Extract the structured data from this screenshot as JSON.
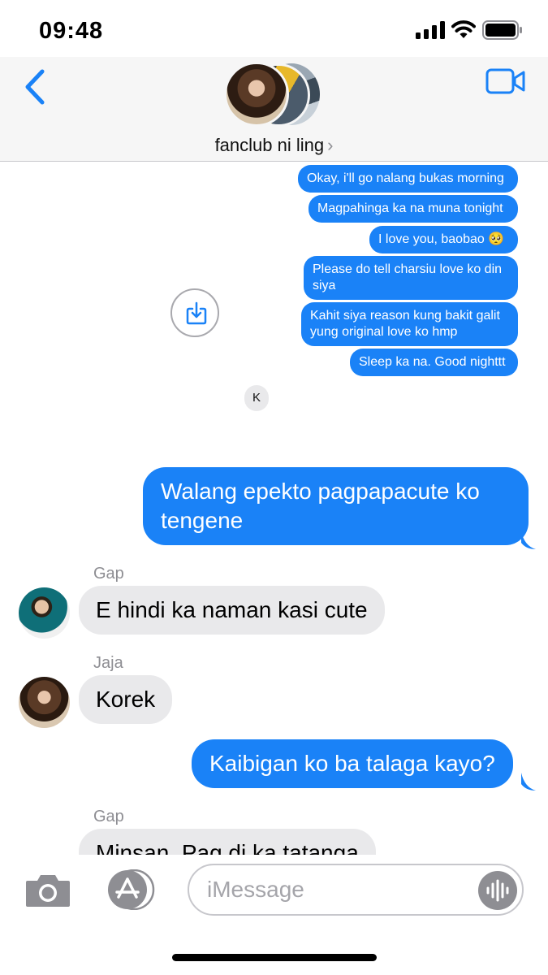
{
  "status_bar": {
    "time": "09:48"
  },
  "header": {
    "group_name": "fanclub ni ling",
    "chevron": "›",
    "icons": {
      "back": "chevron-left-icon",
      "video": "video-camera-icon"
    },
    "accent_color": "#1a82f7"
  },
  "quoted_screenshot": {
    "outgoing_messages": [
      "Okay, i'll go nalang bukas morning",
      "Magpahinga ka na muna tonight",
      "I love you, baobao 🥺",
      "Please do tell charsiu love ko din siya",
      "Kahit siya reason kung bakit galit yung original love ko hmp",
      "Sleep ka na. Good nighttt"
    ],
    "incoming_message": "K"
  },
  "conversation": {
    "messages": [
      {
        "sender": "",
        "direction": "outgoing",
        "text": "Walang epekto pagpapacute ko tengene"
      },
      {
        "sender": "Gap",
        "direction": "incoming",
        "text": "E hindi ka naman kasi cute"
      },
      {
        "sender": "Jaja",
        "direction": "incoming",
        "text": "Korek"
      },
      {
        "sender": "",
        "direction": "outgoing",
        "text": "Kaibigan ko ba talaga kayo?"
      },
      {
        "sender": "Gap",
        "direction": "incoming",
        "text": "Minsan. Pag di ka tatanga"
      }
    ]
  },
  "input_bar": {
    "placeholder": "iMessage",
    "value": "",
    "icons": {
      "camera": "camera-icon",
      "apps": "app-store-icon",
      "audio": "audio-waveform-icon"
    }
  },
  "colors": {
    "outgoing_bubble": "#1a82f7",
    "incoming_bubble": "#e9e9eb",
    "secondary_text": "#8e8e93"
  }
}
